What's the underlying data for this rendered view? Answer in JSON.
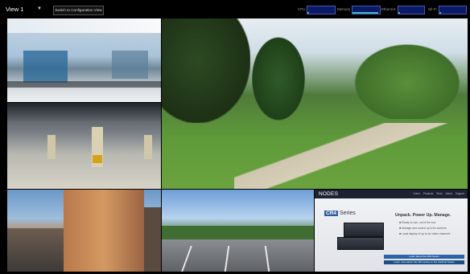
{
  "toolbar": {
    "view_select": "View 1",
    "switch_button": "Switch to Configuration View",
    "meters": [
      {
        "label": "CPU",
        "level": 0.05
      },
      {
        "label": "Memory",
        "level": 0.95
      },
      {
        "label": "Ethernet",
        "level": 0.05
      },
      {
        "label": "Wi-Fi",
        "level": 0.05
      }
    ]
  },
  "tiles": {
    "website": {
      "logo": "NODES",
      "nav": "Home Products Store About Support",
      "series": "CR4",
      "series_word": "Series",
      "headline": "Unpack. Power Up. Manage.",
      "bullets": [
        "Ready to use, out of the box",
        "Manage and control up to fix screens",
        "Local display of up to six video channels"
      ],
      "cta": "Learn about the CR4 Series",
      "cta2": "Learn more about the CR4 series on the Cardinal Nodes"
    }
  },
  "colors": {
    "meter_bg": "#0a1a66",
    "meter_fill": "#3bb7c9",
    "accent": "#2a63a8"
  }
}
